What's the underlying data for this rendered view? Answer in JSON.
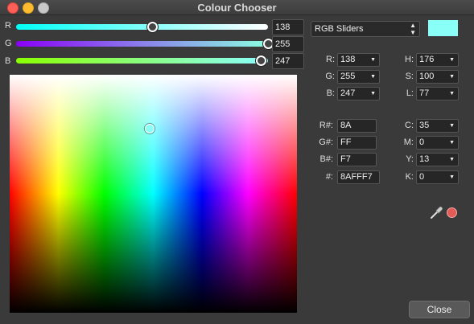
{
  "window": {
    "title": "Colour Chooser"
  },
  "sliders": [
    {
      "label": "R",
      "value": "138",
      "fraction": 0.54
    },
    {
      "label": "G",
      "value": "255",
      "fraction": 1.0
    },
    {
      "label": "B",
      "value": "247",
      "fraction": 0.97
    }
  ],
  "mode": {
    "selected": "RGB Sliders"
  },
  "current_color": "#8AFFF7",
  "rgb_fields": [
    {
      "label": "R:",
      "value": "138"
    },
    {
      "label": "G:",
      "value": "255"
    },
    {
      "label": "B:",
      "value": "247"
    }
  ],
  "hsl_fields": [
    {
      "label": "H:",
      "value": "176"
    },
    {
      "label": "S:",
      "value": "100"
    },
    {
      "label": "L:",
      "value": "77"
    }
  ],
  "hex_fields": [
    {
      "label": "R#:",
      "value": "8A"
    },
    {
      "label": "G#:",
      "value": "FF"
    },
    {
      "label": "B#:",
      "value": "F7"
    },
    {
      "label": "#:",
      "value": "8AFFF7"
    }
  ],
  "cmyk_fields": [
    {
      "label": "C:",
      "value": "35"
    },
    {
      "label": "M:",
      "value": "0"
    },
    {
      "label": "Y:",
      "value": "13"
    },
    {
      "label": "K:",
      "value": "0"
    }
  ],
  "close_button": {
    "label": "Close"
  },
  "icons": {
    "eyedropper": "eyedropper-icon",
    "swatch_dot": "red-circle-icon"
  }
}
